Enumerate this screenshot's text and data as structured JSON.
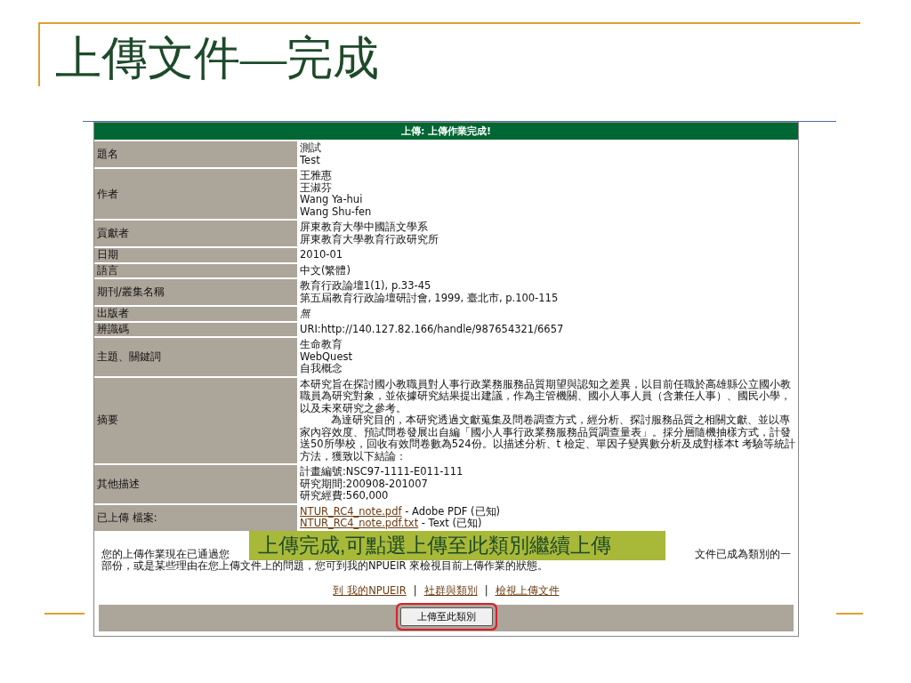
{
  "slide": {
    "title": "上傳文件—完成"
  },
  "panel": {
    "header": "上傳: 上傳作業完成!",
    "rows": [
      {
        "kind": "lines",
        "label": "題名",
        "values": [
          "測試",
          "Test"
        ]
      },
      {
        "kind": "lines",
        "label": "作者",
        "values": [
          "王雅惠",
          "王淑芬",
          "Wang Ya-hui",
          "Wang Shu-fen"
        ]
      },
      {
        "kind": "lines",
        "label": "貢獻者",
        "values": [
          "屏東教育大學中國語文學系",
          "屏東教育大學教育行政研究所"
        ]
      },
      {
        "kind": "lines",
        "label": "日期",
        "values": [
          "2010-01"
        ]
      },
      {
        "kind": "lines",
        "label": "語言",
        "values": [
          "中文(繁體)"
        ]
      },
      {
        "kind": "lines",
        "label": "期刊/叢集名稱",
        "values": [
          "教育行政論壇1(1), p.33-45",
          "第五屆教育行政論壇研討會, 1999, 臺北市, p.100-115"
        ]
      },
      {
        "kind": "italic",
        "label": "出版者",
        "values": [
          "無"
        ]
      },
      {
        "kind": "lines",
        "label": "辨識碼",
        "values": [
          "URI:http://140.127.82.166/handle/987654321/6657"
        ]
      },
      {
        "kind": "lines",
        "label": "主題、關鍵詞",
        "values": [
          "生命教育",
          "WebQuest",
          "自我概念"
        ]
      },
      {
        "kind": "paragraphs",
        "label": "摘要",
        "values": [
          "本研究旨在探討國小教職員對人事行政業務服務品質期望與認知之差異，以目前任職於高雄縣公立國小教職員為研究對象，並依據研究結果提出建議，作為主管機關、國小人事人員（含兼任人事）、國民小學，以及未來研究之參考。",
          "為達研究目的，本研究透過文獻蒐集及問卷調查方式，經分析、探討服務品質之相關文獻、並以專家內容效度、預試問卷發展出自編「國小人事行政業務服務品質調查量表」。採分層隨機抽樣方式，計發送50所學校，回收有效問卷數為524份。以描述分析、t 檢定、單因子變異數分析及成對樣本t 考驗等統計方法，獲致以下結論："
        ]
      },
      {
        "kind": "lines",
        "label": "其他描述",
        "values": [
          "計畫編號:NSC97-1111-E011-111",
          "研究期間:200908-201007",
          "研究經費:560,000"
        ]
      },
      {
        "kind": "files",
        "label": "已上傳 檔案:",
        "files": [
          {
            "link": "NTUR_RC4_note.pdf",
            "detail": " - Adobe PDF (已知)"
          },
          {
            "link": "NTUR_RC4_note.pdf.txt",
            "detail": " - Text (已知)"
          }
        ]
      }
    ],
    "notice": {
      "line1_left": "您的上傳作業現在已通過您",
      "line1_right": "文件已成為類別的一",
      "line2": "部份，或是某些理由在您上傳文件上的問題，您可到我的NPUEIR 來檢視目前上傳作業的狀態。"
    },
    "links": [
      {
        "kind": "link",
        "text": "到 我的NPUEIR"
      },
      {
        "kind": "separator",
        "text": "|"
      },
      {
        "kind": "link",
        "text": "社群與類別"
      },
      {
        "kind": "separator",
        "text": "|"
      },
      {
        "kind": "link",
        "text": "檢視上傳文件"
      }
    ],
    "button": "上傳至此類別"
  },
  "callout": "上傳完成,可點選上傳至此類別繼續上傳"
}
